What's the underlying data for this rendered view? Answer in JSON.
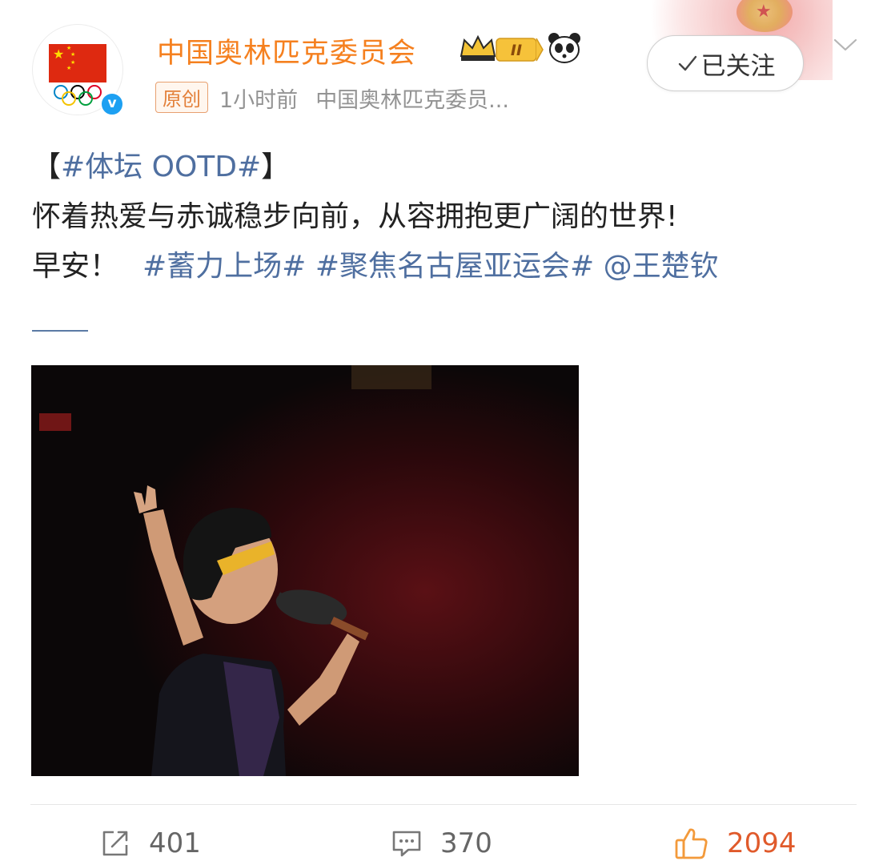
{
  "header": {
    "username": "中国奥林匹克委员会",
    "badge_level": "II",
    "original_badge": "原创",
    "time": "1小时前",
    "source": "中国奥林匹克委员...",
    "follow_label": "已关注"
  },
  "post": {
    "line1_bracket_open": "【",
    "line1_tag": "#体坛 OOTD#",
    "line1_bracket_close": "】",
    "line2": "怀着热爱与赤诚稳步向前，从容拥抱更广阔的世界!",
    "line3_text": "早安！",
    "tag1": "#蓄力上场#",
    "tag2": "#聚焦名古屋亚运会#",
    "mention": "@王楚钦"
  },
  "actions": {
    "repost_count": "401",
    "comment_count": "370",
    "like_count": "2094"
  },
  "colors": {
    "username": "#f5801f",
    "link": "#4f6fa0",
    "like": "#e05a2b",
    "verified": "#1da0f2"
  },
  "icons": [
    "verified-icon",
    "crown-badge-icon",
    "panda-icon",
    "check-icon",
    "chevron-down-icon",
    "repost-icon",
    "comment-icon",
    "like-icon"
  ]
}
